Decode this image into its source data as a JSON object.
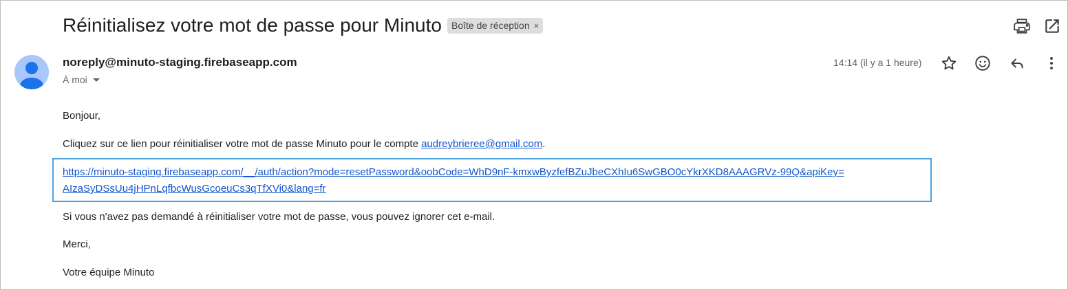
{
  "email": {
    "subject": "Réinitialisez votre mot de passe pour Minuto",
    "label": "Boîte de réception",
    "label_remove": "×",
    "sender": "noreply@minuto-staging.firebaseapp.com",
    "recipient": "À moi",
    "time": "14:14 (il y a 1 heure)"
  },
  "toolbar": {
    "print_icon": "print-icon",
    "open_new_window_icon": "open-in-new-window-icon"
  },
  "actions": {
    "star_icon": "star-icon",
    "emoji_icon": "emoji-reaction-icon",
    "reply_icon": "reply-icon",
    "more_icon": "more-vertical-icon"
  },
  "body": {
    "greeting": "Bonjour,",
    "instruction_prefix": "Cliquez sur ce lien pour réinitialiser votre mot de passe Minuto pour le compte ",
    "account_email": "audreybrieree@gmail.com",
    "instruction_suffix": ".",
    "reset_link_line1": "https://minuto-staging.firebaseapp.com/__/auth/action?mode=resetPassword&oobCode=WhD9nF-kmxwByzfefBZuJbeCXhIu6SwGBO0cYkrXKD8AAAGRVz-99Q&apiKey=",
    "reset_link_line2": "AIzaSyDSsUu4jHPnLqfbcWusGcoeuCs3qTfXVi0&lang=fr",
    "ignore_note": "Si vous n'avez pas demandé à réinitialiser votre mot de passe, vous pouvez ignorer cet e-mail.",
    "thanks": "Merci,",
    "signature": "Votre équipe Minuto"
  },
  "colors": {
    "link": "#1155cc",
    "highlight_border": "#4aa3df",
    "avatar_bg": "#a8c7fa",
    "avatar_fg": "#1a73e8"
  }
}
